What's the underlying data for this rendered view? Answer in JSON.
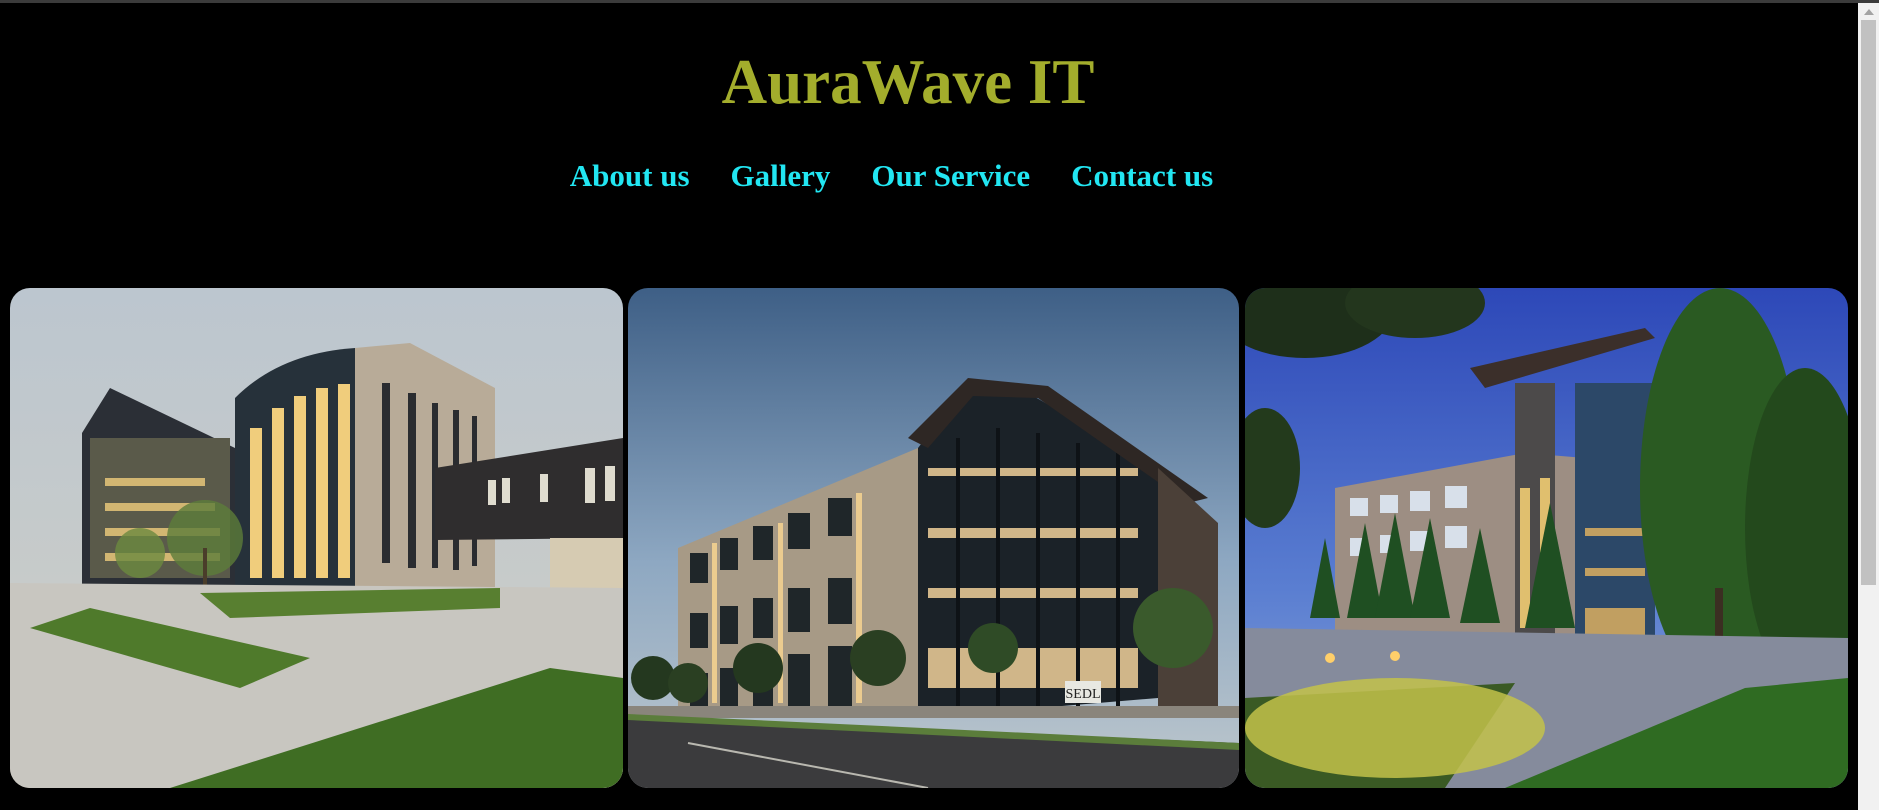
{
  "site": {
    "title": "AuraWave IT"
  },
  "nav": {
    "items": [
      {
        "label": "About us"
      },
      {
        "label": "Gallery"
      },
      {
        "label": "Our Service"
      },
      {
        "label": "Contact us"
      }
    ]
  },
  "gallery": {
    "images": [
      {
        "alt": "building-photo-1"
      },
      {
        "alt": "building-photo-2",
        "sign": "SEDL"
      },
      {
        "alt": "building-photo-3"
      }
    ]
  },
  "colors": {
    "background": "#000000",
    "title": "#a3ad2c",
    "nav_link": "#22e6f2"
  }
}
